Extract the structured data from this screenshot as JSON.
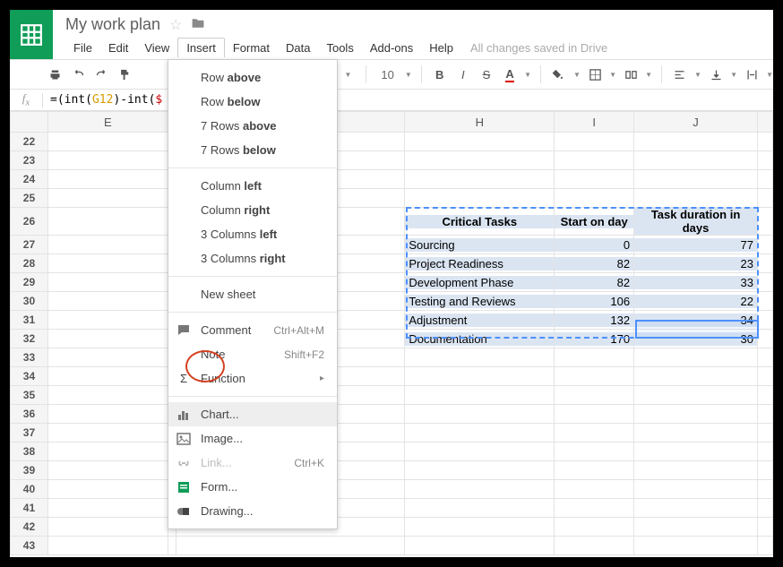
{
  "title": "My work plan",
  "menubar": [
    "File",
    "Edit",
    "View",
    "Insert",
    "Format",
    "Data",
    "Tools",
    "Add-ons",
    "Help"
  ],
  "saved": "All changes saved in Drive",
  "fontsize": "10",
  "formula": "=(int(G12)-int($",
  "formula_g": "G12",
  "formula_pre": "=(int(",
  "formula_mid": ")-int(",
  "formula_r": "$",
  "columns_left": "E",
  "columns": [
    "H",
    "I",
    "J"
  ],
  "rows_start": 22,
  "rows_end": 43,
  "table": {
    "header": [
      "Critical Tasks",
      "Start on day",
      "Task duration in days"
    ],
    "rows": [
      [
        "Sourcing",
        "0",
        "77"
      ],
      [
        "Project Readiness",
        "82",
        "23"
      ],
      [
        "Development Phase",
        "82",
        "33"
      ],
      [
        "Testing and Reviews",
        "106",
        "22"
      ],
      [
        "Adjustment",
        "132",
        "34"
      ],
      [
        "Documentation",
        "170",
        "30"
      ]
    ]
  },
  "menu": {
    "row_above": "Row above",
    "row_below": "Row below",
    "rows7_above": "7 Rows above",
    "rows7_below": "7 Rows below",
    "col_left": "Column left",
    "col_right": "Column right",
    "cols3_left": "3 Columns left",
    "cols3_right": "3 Columns right",
    "new_sheet": "New sheet",
    "comment": "Comment",
    "comment_k": "Ctrl+Alt+M",
    "note": "Note",
    "note_k": "Shift+F2",
    "function": "Function",
    "chart": "Chart...",
    "image": "Image...",
    "link": "Link...",
    "link_k": "Ctrl+K",
    "form": "Form...",
    "drawing": "Drawing..."
  }
}
